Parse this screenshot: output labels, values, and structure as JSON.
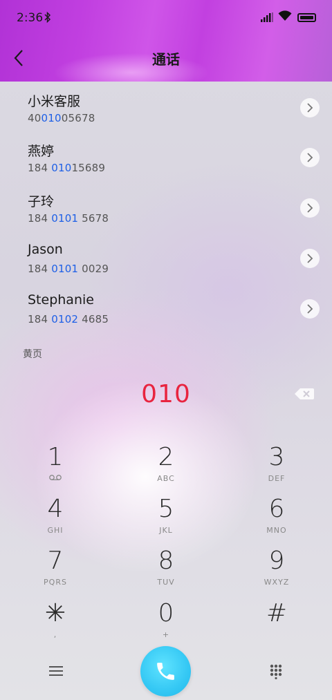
{
  "status_bar": {
    "time": "2:36"
  },
  "header": {
    "title": "通话"
  },
  "contacts": [
    {
      "name": "小米客服",
      "number_pre": "40",
      "number_hl": "010",
      "number_post": "05678"
    },
    {
      "name": "燕婷",
      "number_pre": "184 ",
      "number_hl": "010",
      "number_post": "15689"
    },
    {
      "name": "子玲",
      "number_pre": "184 ",
      "number_hl": "0101",
      "number_post": " 5678"
    },
    {
      "name": "Jason",
      "number_pre": "184 ",
      "number_hl": "0101",
      "number_post": " 0029"
    },
    {
      "name": "Stephanie",
      "number_pre": "184 ",
      "number_hl": "0102",
      "number_post": " 4685"
    }
  ],
  "section_label": "黄页",
  "dialed_number": "010",
  "keypad": [
    {
      "digit": "1",
      "letters": ""
    },
    {
      "digit": "2",
      "letters": "ABC"
    },
    {
      "digit": "3",
      "letters": "DEF"
    },
    {
      "digit": "4",
      "letters": "GHI"
    },
    {
      "digit": "5",
      "letters": "JKL"
    },
    {
      "digit": "6",
      "letters": "MNO"
    },
    {
      "digit": "7",
      "letters": "PQRS"
    },
    {
      "digit": "8",
      "letters": "TUV"
    },
    {
      "digit": "9",
      "letters": "WXYZ"
    },
    {
      "digit": "✳",
      "letters": ","
    },
    {
      "digit": "0",
      "letters": "+"
    },
    {
      "digit": "#",
      "letters": ""
    }
  ],
  "icons": {
    "back": "chevron-left-icon",
    "voicemail": "voicemail-icon",
    "menu": "menu-icon",
    "call": "phone-icon",
    "dialpad": "dialpad-icon",
    "backspace": "backspace-icon"
  },
  "colors": {
    "highlight": "#1d5fe6",
    "dialed": "#e8243f",
    "call_button": "#35c8f4"
  }
}
